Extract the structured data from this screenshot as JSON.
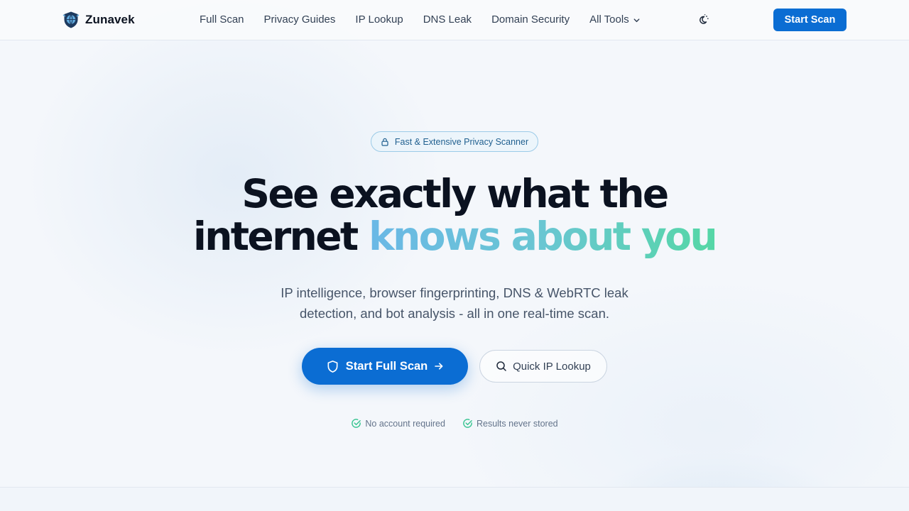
{
  "brand": {
    "name": "Zunavek",
    "logo_icon": "shield-globe-icon"
  },
  "nav": {
    "links": [
      "Full Scan",
      "Privacy Guides",
      "IP Lookup",
      "DNS Leak",
      "Domain Security"
    ],
    "dropdown_label": "All Tools",
    "theme_toggle_icon": "sun-moon-icon",
    "cta_label": "Start Scan"
  },
  "hero": {
    "badge": {
      "icon": "lock-icon",
      "text": "Fast & Extensive Privacy Scanner"
    },
    "headline": {
      "line1": "See exactly what the",
      "line2_plain": "internet ",
      "line2_highlight": "knows about you"
    },
    "subheadline_line1": "IP intelligence, browser fingerprinting, DNS & WebRTC leak",
    "subheadline_line2": "detection, and bot analysis - all in one real-time scan.",
    "primary_button": {
      "label": "Start Full Scan",
      "icon": "shield-icon",
      "trailing_icon": "arrow-right-icon"
    },
    "secondary_button": {
      "label": "Quick IP Lookup",
      "icon": "search-icon"
    },
    "trust_items": [
      "No account required",
      "Results never stored"
    ]
  },
  "colors": {
    "accent": "#0b6dd3",
    "gradient_start": "#6ab8e6",
    "gradient_end": "#55d7a6",
    "check_green": "#34c38f"
  }
}
